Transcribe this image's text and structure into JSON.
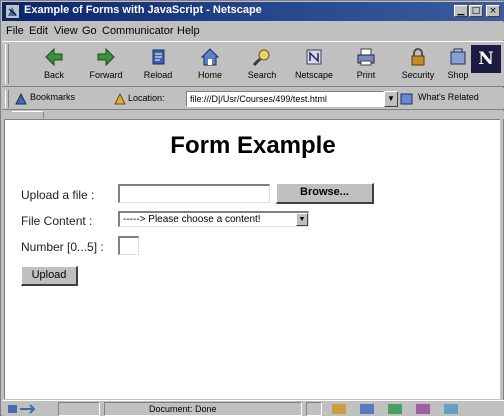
{
  "window": {
    "title": "Example of Forms with JavaScript - Netscape",
    "minimize_glyph": "▁",
    "maximize_glyph": "□",
    "close_glyph": "×"
  },
  "menu": [
    "File",
    "Edit",
    "View",
    "Go",
    "Communicator",
    "Help"
  ],
  "toolbar": {
    "buttons": [
      {
        "label": "Back",
        "icon": "back-arrow-icon"
      },
      {
        "label": "Forward",
        "icon": "forward-arrow-icon"
      },
      {
        "label": "Reload",
        "icon": "reload-icon"
      },
      {
        "label": "Home",
        "icon": "home-icon"
      },
      {
        "label": "Search",
        "icon": "search-icon"
      },
      {
        "label": "Netscape",
        "icon": "netscape-icon"
      },
      {
        "label": "Print",
        "icon": "print-icon"
      },
      {
        "label": "Security",
        "icon": "lock-icon"
      },
      {
        "label": "Shop",
        "icon": "shop-icon"
      }
    ],
    "logo_letter": "N"
  },
  "location": {
    "bookmarks_label": "Bookmarks",
    "location_label": "Location:",
    "url": "file:///D|/Usr/Courses/499/test.html",
    "related_label": "What's Related"
  },
  "page": {
    "heading": "Form Example",
    "upload_label": "Upload a file   :",
    "browse_label": "Browse...",
    "content_label": "File Content   :",
    "content_selected": "-----> Please choose a content!",
    "number_label": "Number [0...5] :",
    "number_value": "",
    "upload_button": "Upload"
  },
  "status": {
    "text": "Document: Done"
  },
  "colors": {
    "title_bar": "#0a246a",
    "chrome": "#c0c0c0",
    "page_bg": "#ffffff"
  }
}
